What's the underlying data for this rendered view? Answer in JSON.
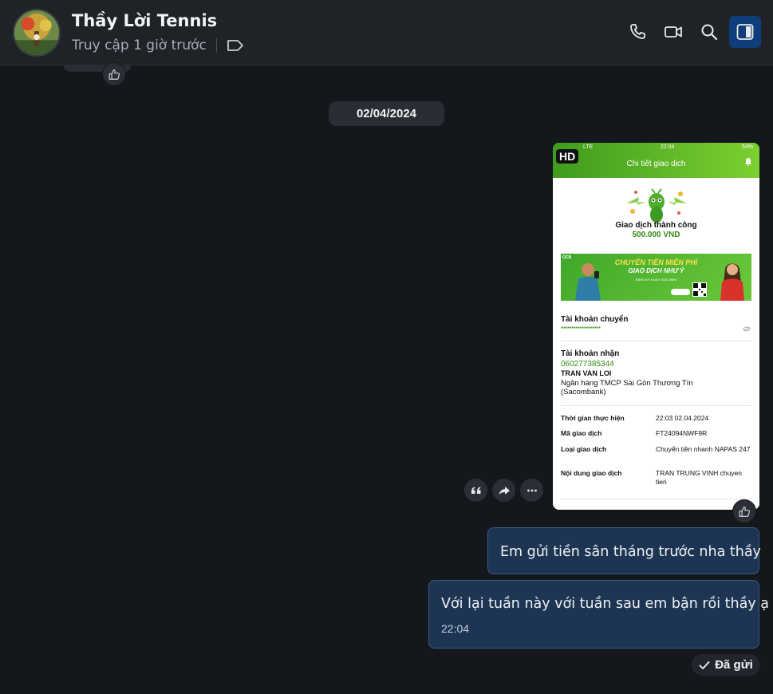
{
  "header": {
    "contact_name": "Thầy Lời Tennis",
    "status": "Truy cập 1 giờ trước"
  },
  "conversation": {
    "date_separator": "02/04/2024",
    "image_message": {
      "hd_badge": "HD",
      "receipt": {
        "status_bar_carrier": "LTE",
        "status_bar_time": "22:04",
        "status_bar_battery": "54%",
        "screen_title": "Chi tiết giao dịch",
        "success_title": "Giao dịch thành công",
        "amount": "500.000 VND",
        "banner_logo": "OCB",
        "banner_line1": "CHUYỂN TIỀN MIỄN PHÍ",
        "banner_line2": "GIAO DỊCH NHƯ Ý",
        "banner_line3": "ĐĂNG KÝ NGAY OCB OMNI",
        "sender_label": "Tài khoản chuyển",
        "sender_masked": "*******************",
        "receiver_label": "Tài khoản nhận",
        "receiver_account": "060277385344",
        "receiver_name": "TRAN VAN LOI",
        "receiver_bank": "Ngân hàng TMCP Sài Gòn Thương Tín (Sacombank)",
        "rows": [
          {
            "label": "Thời gian thực hiện",
            "value": "22:03 02.04.2024"
          },
          {
            "label": "Mã giao dịch",
            "value": "FT24094NWF9R"
          },
          {
            "label": "Loại giao dịch",
            "value": "Chuyển tiền nhanh NAPAS 247"
          },
          {
            "label": "Nội dung giao dịch",
            "value": "TRAN TRUNG VINH chuyen tien"
          }
        ]
      }
    },
    "messages": [
      {
        "text": "Em gửi tiền sân tháng trước nha thầy"
      },
      {
        "text": "Với lại tuần này với tuần sau em bận rồi thầy ạ",
        "time": "22:04"
      }
    ],
    "delivery_status": "Đã gửi"
  },
  "icons": {
    "call": "phone-icon",
    "video": "video-icon",
    "search": "search-icon",
    "panel": "sidebar-toggle-icon",
    "like": "thumbs-up-icon",
    "quote": "quote-icon",
    "forward": "forward-icon",
    "more": "more-icon",
    "check": "check-icon"
  },
  "colors": {
    "bubble_bg": "#1d3553",
    "active_button": "#0f3d7a",
    "receipt_green": "#2f8a14"
  }
}
